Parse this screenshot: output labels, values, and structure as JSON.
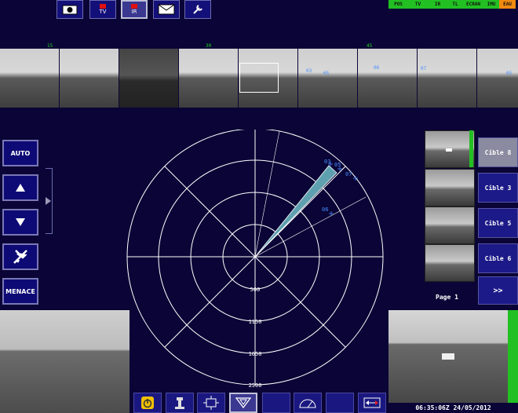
{
  "toolbar": {
    "tv_label": "TV",
    "ir_label": "IR"
  },
  "status": [
    {
      "label": "POS",
      "color": "#22c022"
    },
    {
      "label": "TV",
      "color": "#22c022"
    },
    {
      "label": "IR",
      "color": "#22c022"
    },
    {
      "label": "TL",
      "color": "#22c022"
    },
    {
      "label": "ECRAN",
      "color": "#22c022"
    },
    {
      "label": "IMU",
      "color": "#22c022"
    },
    {
      "label": "EAU",
      "color": "#f08a10"
    }
  ],
  "panorama": {
    "bearings": [
      "15",
      "30",
      "45"
    ],
    "targets": [
      "03",
      "05",
      "06",
      "07",
      "05"
    ]
  },
  "left_controls": {
    "auto_label": "AUTO",
    "menace_label": "MENACE"
  },
  "radar": {
    "ranges": [
      "500",
      "1150",
      "1650",
      "2500"
    ],
    "targets": [
      "03",
      "05",
      "07",
      "06"
    ]
  },
  "targets_panel": {
    "items": [
      {
        "label": "Cible 8",
        "active": true
      },
      {
        "label": "Cible 3",
        "active": false
      },
      {
        "label": "Cible 5",
        "active": false
      },
      {
        "label": "Cible 6",
        "active": false
      }
    ],
    "page_label": "Page 1",
    "next_label": ">>"
  },
  "clock": "06:35:06Z 24/05/2012",
  "colors": {
    "background": "#0a0536",
    "accent_green": "#22c022",
    "alert_orange": "#f08a10",
    "target_blue": "#4a8cff"
  }
}
